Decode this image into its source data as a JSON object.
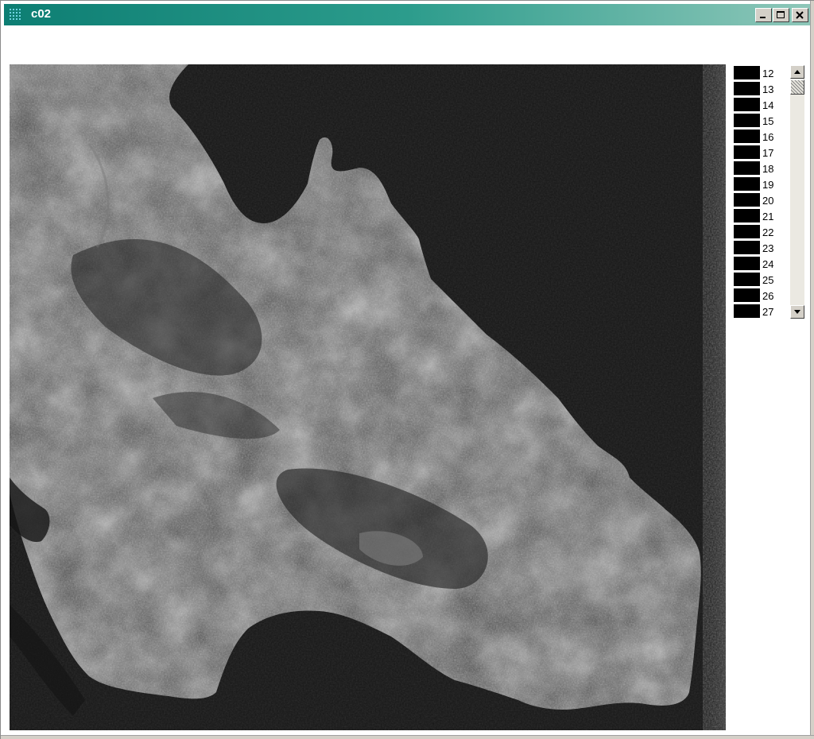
{
  "window": {
    "title": "c02"
  },
  "titlebar_controls": [
    "minimize",
    "maximize",
    "close"
  ],
  "legend": {
    "entries": [
      "12",
      "13",
      "14",
      "15",
      "16",
      "17",
      "18",
      "19",
      "20",
      "21",
      "22",
      "23",
      "24",
      "25",
      "26",
      "27"
    ],
    "swatch_color": "#000000"
  },
  "colors": {
    "titlebar_start": "#0d7e73",
    "titlebar_end": "#8ec7b9",
    "image_background": "#141414",
    "land": "#4a4a4a"
  },
  "icons": {
    "app": "grid-app-icon",
    "minimize": "minimize-icon",
    "maximize": "maximize-icon",
    "close": "close-icon",
    "scroll_up": "arrow-up-icon",
    "scroll_down": "arrow-down-icon"
  }
}
